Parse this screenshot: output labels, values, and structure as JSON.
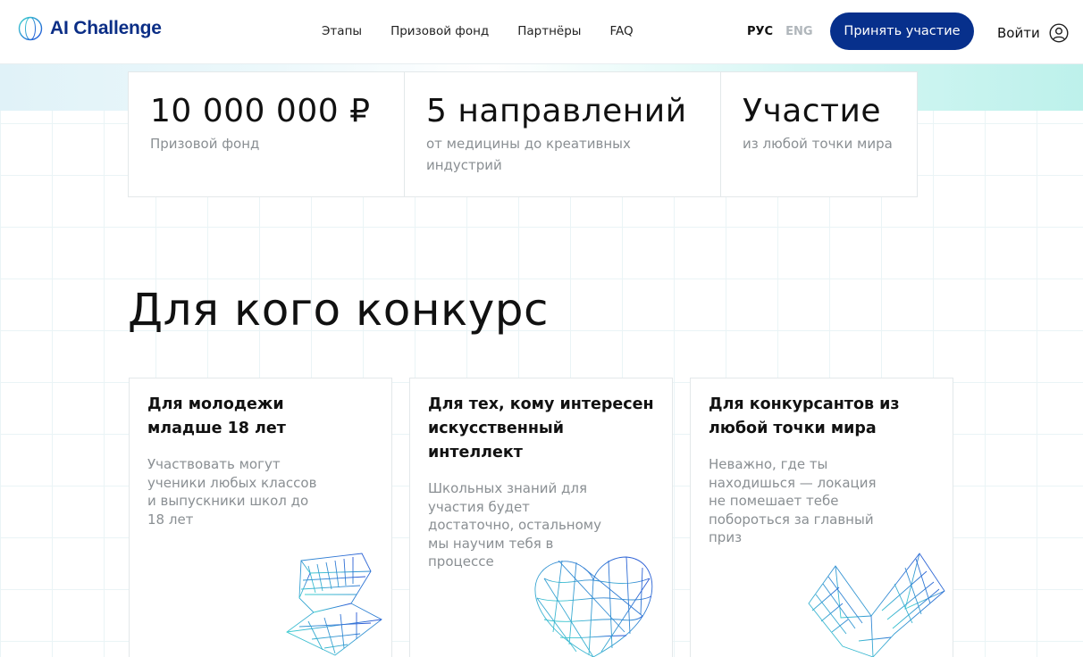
{
  "header": {
    "logo_text": "AI Challenge",
    "nav": [
      "Этапы",
      "Призовой фонд",
      "Партнёры",
      "FAQ"
    ],
    "lang_active": "РУС",
    "lang_inactive": "ENG",
    "cta_label": "Принять участие",
    "login_label": "Войти"
  },
  "stats": [
    {
      "value": "10 000 000 ₽",
      "label": "Призовой фонд"
    },
    {
      "value": "5 направлений",
      "label": "от медицины до креативных индустрий"
    },
    {
      "value": "Участие",
      "label": "из любой точки мира"
    }
  ],
  "section": {
    "title": "Для кого конкурс",
    "cards": [
      {
        "title": "Для молодежи младше 18 лет",
        "text": "Участвовать могут ученики любых классов и выпускники школ до 18 лет"
      },
      {
        "title": "Для тех, кому интересен искусственный интеллект",
        "text": "Школьных знаний для участия будет достаточно, остальному мы научим тебя в процессе"
      },
      {
        "title": "Для конкурсантов из любой точки мира",
        "text": "Неважно, где ты находишься — локация не помешает тебе побороться за главный приз"
      }
    ]
  },
  "colors": {
    "brand": "#07308c",
    "logo_text": "#0b2e86",
    "muted_text": "#8a8f93",
    "accent_cyan": "#3fd3cf"
  },
  "icons": [
    "globe-logo-icon",
    "user-circle-icon",
    "wireframe-bolt-icon",
    "wireframe-heart-icon",
    "wireframe-check-icon"
  ]
}
